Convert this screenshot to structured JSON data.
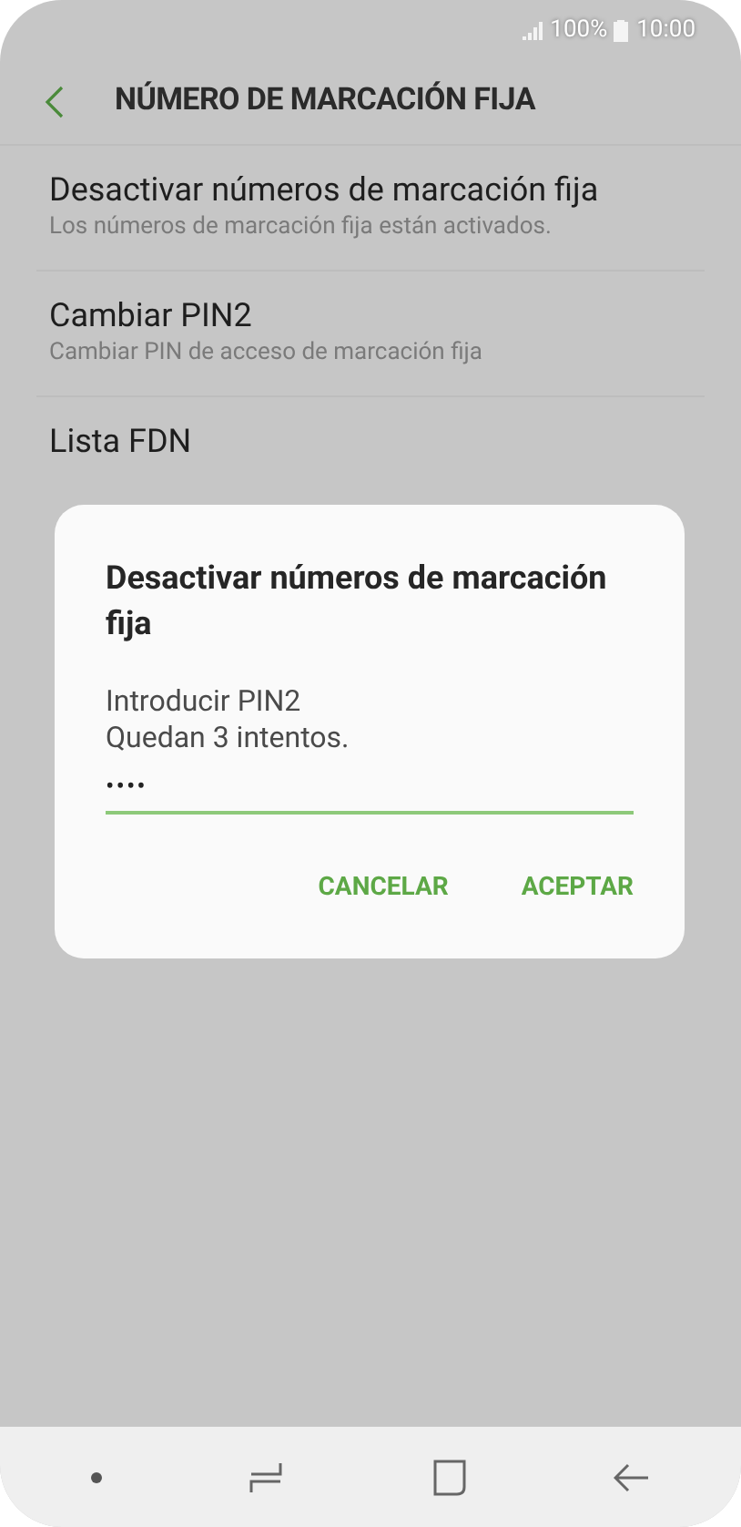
{
  "status_bar": {
    "battery": "100%",
    "time": "10:00"
  },
  "header": {
    "title": "NÚMERO DE MARCACIÓN FIJA"
  },
  "items": [
    {
      "title": "Desactivar números de marcación fija",
      "subtitle": "Los números de marcación fija están activados."
    },
    {
      "title": "Cambiar PIN2",
      "subtitle": "Cambiar PIN de acceso de marcación fija"
    },
    {
      "title": "Lista FDN"
    }
  ],
  "dialog": {
    "title": "Desactivar números de marcación fija",
    "message": "Introducir PIN2",
    "hint": "Quedan 3 intentos.",
    "field": {
      "value": "••••"
    },
    "buttons": [
      "CANCELAR",
      "ACEPTAR"
    ]
  }
}
